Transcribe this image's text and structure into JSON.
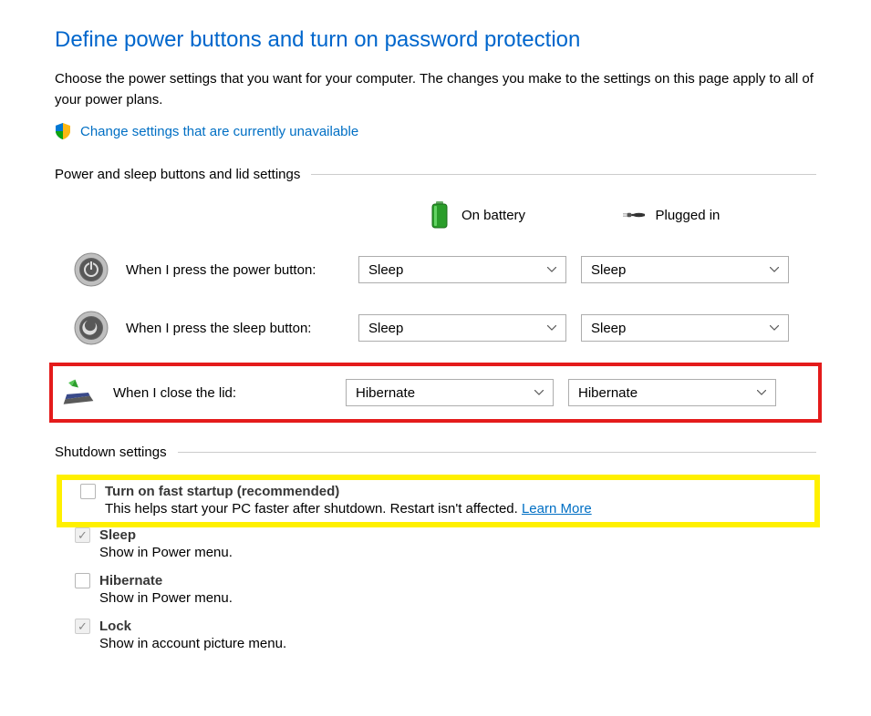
{
  "page": {
    "title": "Define power buttons and turn on password protection",
    "subtitle": "Choose the power settings that you want for your computer. The changes you make to the settings on this page apply to all of your power plans.",
    "change_settings_link": "Change settings that are currently unavailable"
  },
  "section1": {
    "title": "Power and sleep buttons and lid settings",
    "col_battery": "On battery",
    "col_plugged": "Plugged in",
    "rows": [
      {
        "label": "When I press the power button:",
        "battery": "Sleep",
        "plugged": "Sleep"
      },
      {
        "label": "When I press the sleep button:",
        "battery": "Sleep",
        "plugged": "Sleep"
      },
      {
        "label": "When I close the lid:",
        "battery": "Hibernate",
        "plugged": "Hibernate"
      }
    ]
  },
  "section2": {
    "title": "Shutdown settings",
    "fast_startup": {
      "label": "Turn on fast startup (recommended)",
      "desc": "This helps start your PC faster after shutdown. Restart isn't affected. ",
      "learn_more": "Learn More"
    },
    "items": [
      {
        "label": "Sleep",
        "desc": "Show in Power menu.",
        "checked": true
      },
      {
        "label": "Hibernate",
        "desc": "Show in Power menu.",
        "checked": false
      },
      {
        "label": "Lock",
        "desc": "Show in account picture menu.",
        "checked": true
      }
    ]
  }
}
